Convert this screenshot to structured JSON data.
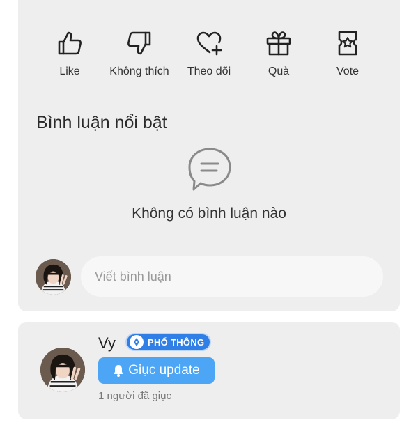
{
  "actions": [
    {
      "label": "Like",
      "icon": "thumbs-up-icon"
    },
    {
      "label": "Không thích",
      "icon": "thumbs-down-icon"
    },
    {
      "label": "Theo dõi",
      "icon": "heart-plus-icon"
    },
    {
      "label": "Quà",
      "icon": "gift-icon"
    },
    {
      "label": "Vote",
      "icon": "ticket-star-icon"
    }
  ],
  "comments": {
    "title": "Bình luận nổi bật",
    "empty_text": "Không có bình luận nào",
    "input_placeholder": "Viết bình luận"
  },
  "author": {
    "name": "Vy",
    "badge": "PHỔ THÔNG",
    "urge_button": "Giục update",
    "urge_count": "1 người đã giục"
  },
  "colors": {
    "card_bg": "#eeeeee",
    "accent": "#4da6f5",
    "badge": "#2f7fe6"
  }
}
